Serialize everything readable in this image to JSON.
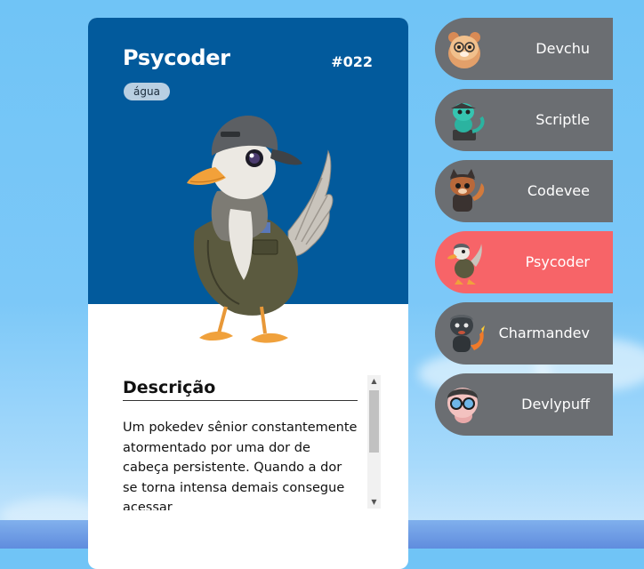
{
  "card": {
    "name": "Psycoder",
    "number": "#022",
    "type": "água",
    "description_title": "Descrição",
    "description": "Um pokedev sênior constantemente atormentado por uma dor de cabeça persistente. Quando a dor se torna intensa demais consegue acessar"
  },
  "list": [
    {
      "name": "Devchu",
      "active": false
    },
    {
      "name": "Scriptle",
      "active": false
    },
    {
      "name": "Codevee",
      "active": false
    },
    {
      "name": "Psycoder",
      "active": true
    },
    {
      "name": "Charmandev",
      "active": false
    },
    {
      "name": "Devlypuff",
      "active": false
    }
  ],
  "colors": {
    "card_header": "#025a9c",
    "list_item": "#6b6e72",
    "list_item_active": "#f76468",
    "type_badge": "#b9cfe2"
  }
}
